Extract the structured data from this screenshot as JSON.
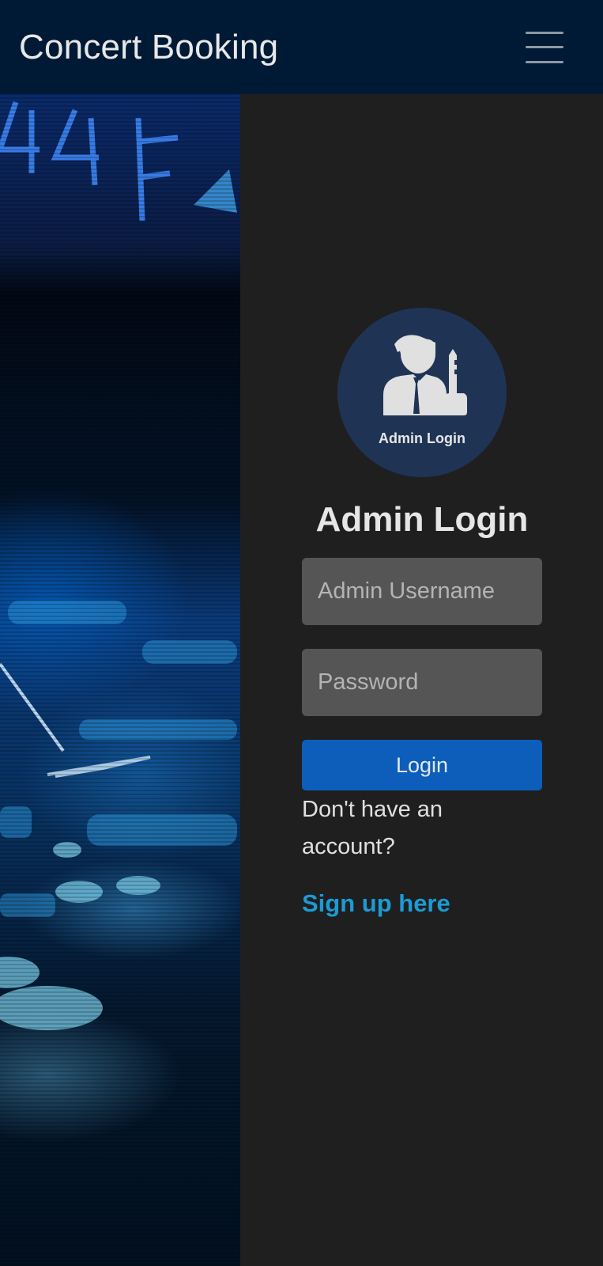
{
  "navbar": {
    "brand": "Concert Booking",
    "menu_icon": "hamburger-menu-icon"
  },
  "login": {
    "avatar_icon": "admin-user-key-icon",
    "avatar_label": "Admin Login",
    "title": "Admin Login",
    "username_placeholder": "Admin Username",
    "password_placeholder": "Password",
    "submit_label": "Login",
    "signup_prompt": "Don't have an account?",
    "signup_link": "Sign up here"
  },
  "colors": {
    "navbar_bg": "#001a35",
    "panel_bg": "#1f1f1f",
    "avatar_bg": "#1f3455",
    "button_bg": "#0d5eba",
    "link": "#1c9bd4",
    "input_bg": "#555555"
  }
}
